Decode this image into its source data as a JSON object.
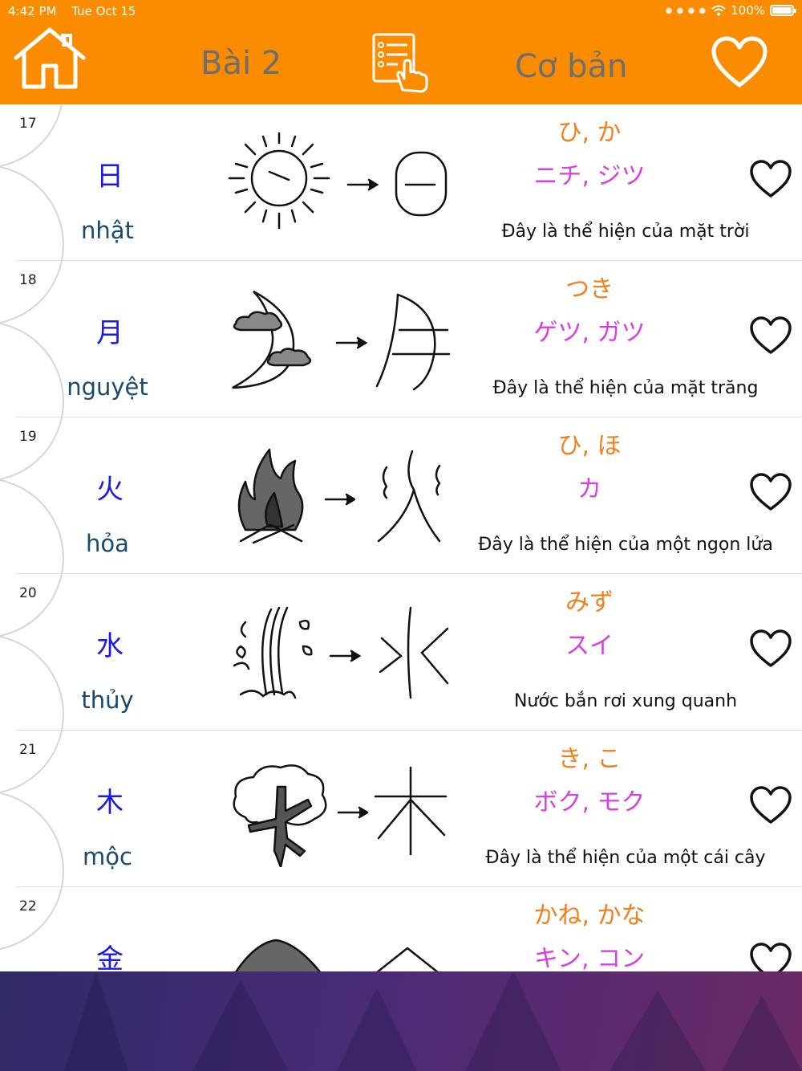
{
  "status_bar": {
    "time": "4:42 PM",
    "date": "Tue Oct 15",
    "battery_text": "100%",
    "battery_level": 1.0,
    "icons": [
      "signal-dots-icon",
      "wifi-icon",
      "battery-icon"
    ]
  },
  "header": {
    "lesson": "Bài 2",
    "level": "Cơ bản",
    "background_color": "#fb8c00",
    "icons": [
      "home-icon",
      "quiz-list-icon",
      "favorite-heart-icon"
    ]
  },
  "items": [
    {
      "number": "17",
      "kanji": "日",
      "sino": "nhật",
      "kun": "ひ, か",
      "on": "ニチ, ジツ",
      "description": "Đây là thể hiện của mặt trời",
      "pictograph": "sun"
    },
    {
      "number": "18",
      "kanji": "月",
      "sino": "nguyệt",
      "kun": "つき",
      "on": "ゲツ, ガツ",
      "description": "Đây là thể hiện của  mặt trăng",
      "pictograph": "moon"
    },
    {
      "number": "19",
      "kanji": "火",
      "sino": "hỏa",
      "kun": "ひ, ほ",
      "on": "カ",
      "description": "Đây là thể hiện của một ngọn lửa",
      "pictograph": "fire"
    },
    {
      "number": "20",
      "kanji": "水",
      "sino": "thủy",
      "kun": "みず",
      "on": "スイ",
      "description": "Nước bắn rơi xung quanh",
      "pictograph": "water"
    },
    {
      "number": "21",
      "kanji": "木",
      "sino": "mộc",
      "kun": "き, こ",
      "on": "ボク, モク",
      "description": "Đây là thể hiện của một cái cây",
      "pictograph": "tree"
    },
    {
      "number": "22",
      "kanji": "金",
      "sino": "",
      "kun": "かね, かな",
      "on": "キン, コン",
      "description": "",
      "pictograph": "metal"
    }
  ],
  "colors": {
    "kanji": "#1a1ae6",
    "sino": "#174a6e",
    "kun": "#f07f1d",
    "on": "#d63fe0",
    "footer": "#4a2b76"
  }
}
